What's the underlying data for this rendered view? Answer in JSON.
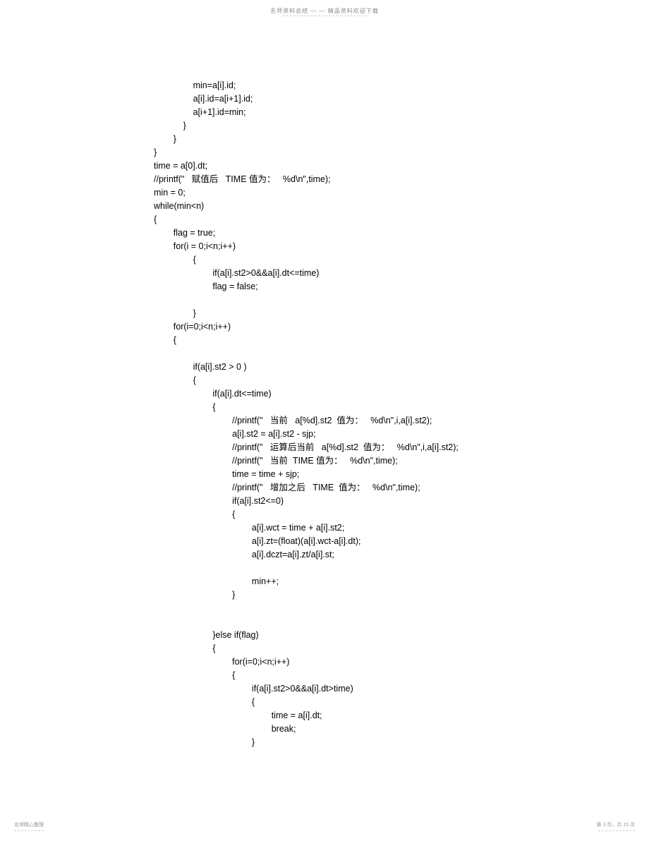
{
  "header": {
    "text": "名师资料总结 — — 精品资料欢迎下载"
  },
  "code": {
    "content": "                min=a[i].id;\n                a[i].id=a[i+1].id;\n                a[i+1].id=min;\n            }\n        }\n}\ntime = a[0].dt;\n//printf(\"   赋值后   TIME 值为：   %d\\n\",time);\nmin = 0;\nwhile(min<n)\n{\n        flag = true;\n        for(i = 0;i<n;i++)\n                {\n                        if(a[i].st2>0&&a[i].dt<=time)\n                        flag = false;\n\n                }\n        for(i=0;i<n;i++)\n        {\n\n                if(a[i].st2 > 0 )\n                {\n                        if(a[i].dt<=time)\n                        {\n                                //printf(\"   当前   a[%d].st2  值为：   %d\\n\",i,a[i].st2);\n                                a[i].st2 = a[i].st2 - sjp;\n                                //printf(\"   运算后当前   a[%d].st2  值为：   %d\\n\",i,a[i].st2);\n                                //printf(\"   当前  TIME 值为：   %d\\n\",time);\n                                time = time + sjp;\n                                //printf(\"   增加之后   TIME  值为：   %d\\n\",time);\n                                if(a[i].st2<=0)\n                                {\n                                        a[i].wct = time + a[i].st2;\n                                        a[i].zt=(float)(a[i].wct-a[i].dt);\n                                        a[i].dczt=a[i].zt/a[i].st;\n\n                                        min++;\n                                }\n\n\n                        }else if(flag)\n                        {\n                                for(i=0;i<n;i++)\n                                {\n                                        if(a[i].st2>0&&a[i].dt>time)\n                                        {\n                                                time = a[i].dt;\n                                                break;\n                                        }"
  },
  "footer": {
    "left": "名师精心整理",
    "right": "第 3 页，共 15 页"
  }
}
